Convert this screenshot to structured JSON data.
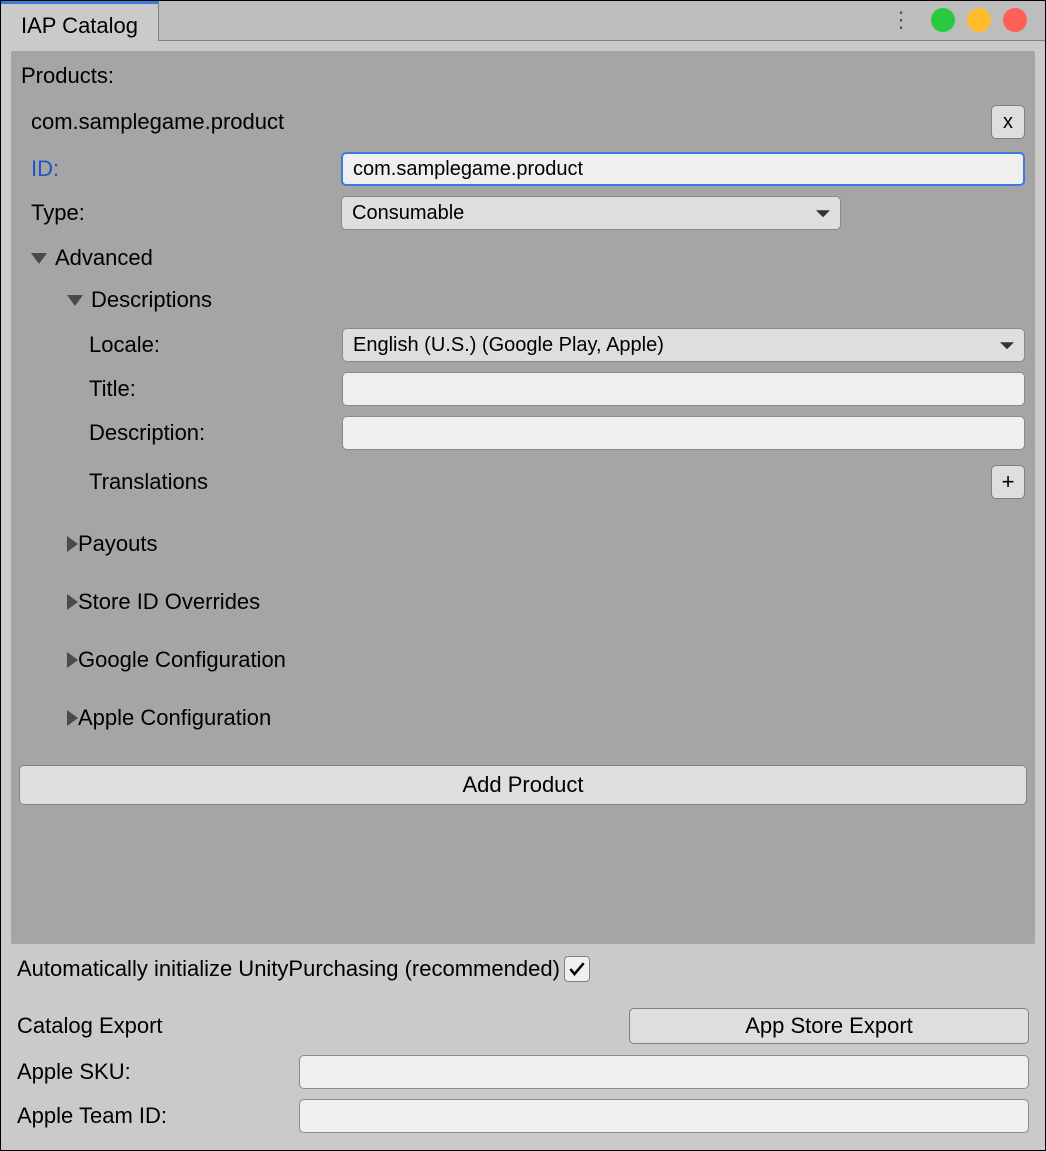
{
  "window": {
    "title": "IAP Catalog"
  },
  "panel": {
    "sectionLabel": "Products:",
    "product": {
      "name": "com.samplegame.product",
      "removeLabel": "x",
      "idLabel": "ID:",
      "idValue": "com.samplegame.product",
      "typeLabel": "Type:",
      "typeValue": "Consumable",
      "advanced": {
        "label": "Advanced",
        "descriptions": {
          "label": "Descriptions",
          "localeLabel": "Locale:",
          "localeValue": "English (U.S.) (Google Play, Apple)",
          "titleLabel": "Title:",
          "titleValue": "",
          "descLabel": "Description:",
          "descValue": "",
          "translationsLabel": "Translations",
          "addLabel": "+"
        },
        "payoutsLabel": "Payouts",
        "storeIdLabel": "Store ID Overrides",
        "googleLabel": "Google Configuration",
        "appleLabel": "Apple Configuration"
      }
    },
    "addProductLabel": "Add Product"
  },
  "bottom": {
    "autoInitLabel": "Automatically initialize UnityPurchasing (recommended)",
    "autoInitChecked": true,
    "catalogExportLabel": "Catalog Export",
    "appStoreExportLabel": "App Store Export",
    "appleSkuLabel": "Apple SKU:",
    "appleSkuValue": "",
    "appleTeamIdLabel": "Apple Team ID:",
    "appleTeamIdValue": ""
  }
}
